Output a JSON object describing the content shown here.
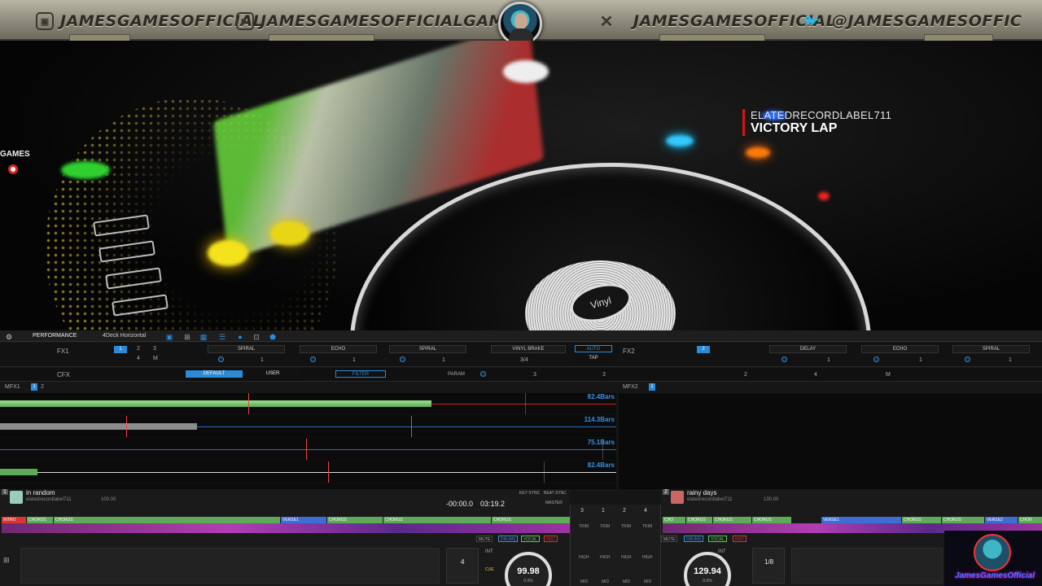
{
  "banner": {
    "handles": [
      {
        "icon": "twitch-icon",
        "text": "JAMESGAMESOFFICIAL"
      },
      {
        "icon": "youtube-icon",
        "text": "JAMESGAMESOFFICIALGAME"
      },
      {
        "icon": "x-icon",
        "text": "JAMESGAMESOFFICIAL"
      },
      {
        "icon": "twitter-icon",
        "text": "@JAMESGAMESOFFIC"
      }
    ]
  },
  "overlay": {
    "games_tag": "GAMES",
    "now_playing": {
      "artist": "ELATEDRECORDLABEL711",
      "title": "VICTORY LAP"
    },
    "corner_logo": "JamesGamesOfficial",
    "disc_label": "Vinyl"
  },
  "toolbar": {
    "mode": "PERFORMANCE",
    "layout": "4Deck Horizontal"
  },
  "fx": {
    "fx1_label": "FX1",
    "fx2_label": "FX2",
    "cfx_label": "CFX",
    "fx1_beats": [
      "1",
      "2",
      "3",
      "4",
      "M"
    ],
    "fx1_slots": [
      "SPIRAL",
      "ECHO",
      "SPIRAL"
    ],
    "fx1_values": [
      "1",
      "1",
      "1"
    ],
    "vinyl_brake": "VINYL BRAKE",
    "vinyl_ratio": "3/4",
    "auto": "AUTO",
    "tap": "TAP",
    "fx2_slots": [
      "DELAY",
      "ECHO",
      "SPIRAL"
    ],
    "fx2_values": [
      "1",
      "1",
      "1"
    ],
    "cfx_default": "DEFAULT",
    "cfx_user": "USER",
    "cfx_filter": "FILTER",
    "cfx_param": "PARAM",
    "cfx_knobs": [
      "3",
      "3",
      "2",
      "4",
      "M"
    ]
  },
  "mfx": {
    "left": "MFX1",
    "right": "MFX2",
    "nums": [
      "1",
      "2"
    ]
  },
  "overview": {
    "lanes": [
      {
        "bars": "82.4Bars",
        "color": "#d33"
      },
      {
        "bars": "114.3Bars",
        "color": "#3b8fe0"
      },
      {
        "bars": "75.1Bars",
        "color": "#3b8fe0"
      },
      {
        "bars": "82.4Bars",
        "color": "#eee"
      }
    ]
  },
  "deck1": {
    "number": "1",
    "track": "in random",
    "artist": "elatedrecordlabel711",
    "bpm_small": "100.00",
    "time_elapsed": "-00:00.0",
    "time_remain": "03:19.2",
    "key_sync": "KEY SYNC",
    "beat_sync": "BEAT SYNC",
    "master": "MASTER",
    "phrases": [
      "INTRO",
      "CHORUS",
      "CHORUS",
      "VERSE1",
      "CHORUS",
      "CHORUS",
      "CHORUS"
    ],
    "bpm": "99.98",
    "pitch": "0.0%",
    "beat_jump": "4",
    "chips": [
      "MUTE",
      "DRUMS",
      "VOCAL",
      "INST"
    ]
  },
  "deck2": {
    "number": "2",
    "track": "rainy days",
    "artist": "elatedrecordlabel711",
    "bpm_small": "130.00",
    "phrases": [
      "CHO",
      "CHORUS",
      "CHORUS",
      "CHORUS",
      "VERSE1",
      "CHORUS",
      "CHORUS",
      "VERSE2",
      "CHOR"
    ],
    "bpm": "129.94",
    "pitch": "0.0%",
    "beat_jump": "1/8",
    "chips": [
      "MUTE",
      "DRUMS",
      "VOCAL",
      "INST"
    ]
  },
  "mixer": {
    "channels": [
      "3",
      "1",
      "2",
      "4"
    ],
    "knobs": [
      "TRIM",
      "HIGH",
      "MID"
    ]
  }
}
